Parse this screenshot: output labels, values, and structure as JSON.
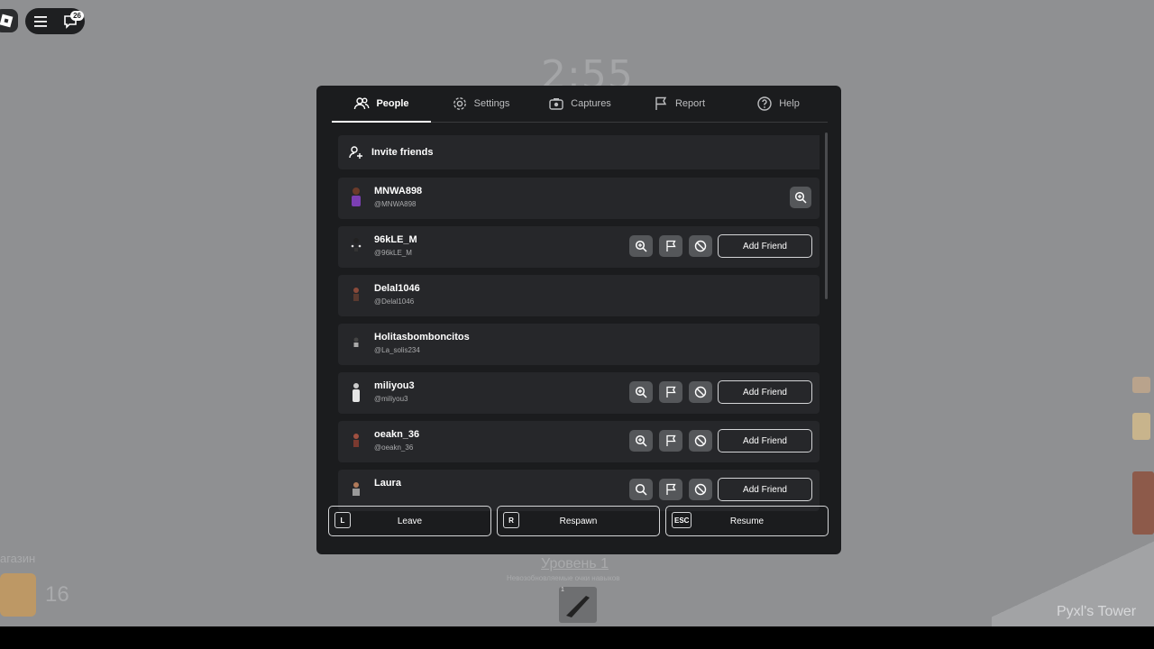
{
  "hud": {
    "timer": "2:55",
    "notification_count": "26",
    "shop_label": "агазин",
    "coins": "16",
    "level": "Уровень 1",
    "level_subtitle": "Невозобновляемые очки навыков",
    "hotbar_slot": "1",
    "place_name": "Pyxl's Tower"
  },
  "tabs": [
    {
      "label": "People",
      "icon": "people-icon",
      "active": true
    },
    {
      "label": "Settings",
      "icon": "gear-icon",
      "active": false
    },
    {
      "label": "Captures",
      "icon": "camera-icon",
      "active": false
    },
    {
      "label": "Report",
      "icon": "flag-icon",
      "active": false
    },
    {
      "label": "Help",
      "icon": "help-icon",
      "active": false
    }
  ],
  "invite": {
    "label": "Invite friends"
  },
  "players": [
    {
      "name": "MNWA898",
      "handle": "@MNWA898",
      "self": true
    },
    {
      "name": "96kLE_M",
      "handle": "@96kLE_M",
      "add_label": "Add Friend"
    },
    {
      "name": "Delal1046",
      "handle": "@Delal1046"
    },
    {
      "name": "Holitasbomboncitos",
      "handle": "@La_solis234"
    },
    {
      "name": "miliyou3",
      "handle": "@miliyou3",
      "add_label": "Add Friend"
    },
    {
      "name": "oeakn_36",
      "handle": "@oeakn_36",
      "add_label": "Add Friend"
    },
    {
      "name": "Laura",
      "handle": "",
      "add_label": "Add Friend"
    }
  ],
  "actions": [
    {
      "key": "L",
      "label": "Leave"
    },
    {
      "key": "R",
      "label": "Respawn"
    },
    {
      "key": "ESC",
      "label": "Resume"
    }
  ],
  "colors": {
    "panel": "#1b1c1e",
    "row": "#26272a",
    "background": "#8f9092"
  }
}
